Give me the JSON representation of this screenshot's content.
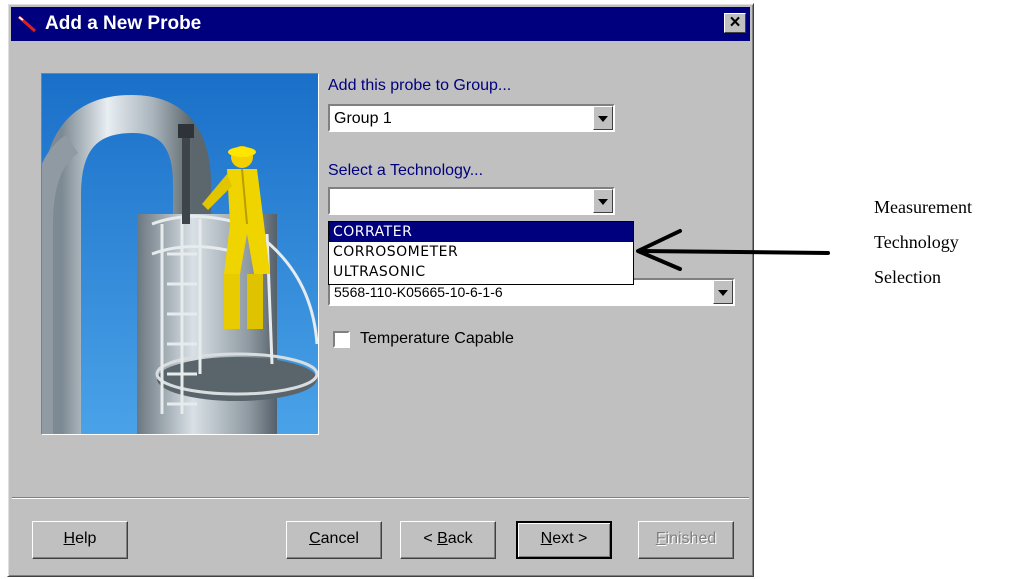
{
  "dialog": {
    "title": "Add a New Probe",
    "close_label": "×"
  },
  "form": {
    "group_label": "Add this probe to Group...",
    "group_value": "Group 1",
    "technology_label": "Select a Technology...",
    "technology_value": "",
    "technology_options": [
      "CORRATER",
      "CORROSOMETER",
      "ULTRASONIC"
    ],
    "selected_option": "CORRATER",
    "probe_value": "5568-110-K05665-10-6-1-6",
    "temperature_label": "Temperature Capable",
    "temperature_checked": false
  },
  "buttons": {
    "help": {
      "pre": "",
      "accel": "H",
      "post": "elp"
    },
    "cancel": {
      "pre": "",
      "accel": "C",
      "post": "ancel"
    },
    "back": {
      "pre": "< ",
      "accel": "B",
      "post": "ack"
    },
    "next": {
      "pre": "",
      "accel": "N",
      "post": "ext >"
    },
    "finished": {
      "pre": "",
      "accel": "F",
      "post": "inished"
    }
  },
  "annotation": {
    "lines": [
      "Measurement",
      "Technology",
      "Selection"
    ]
  },
  "colors": {
    "titlebar": "#00007f",
    "face": "#c0c0c0",
    "label_blue": "#00007f",
    "highlight": "#00007f"
  },
  "icons": [
    "probe-icon",
    "close-icon",
    "dropdown-arrow-icon",
    "checkbox-icon",
    "pointer-arrow-icon"
  ]
}
